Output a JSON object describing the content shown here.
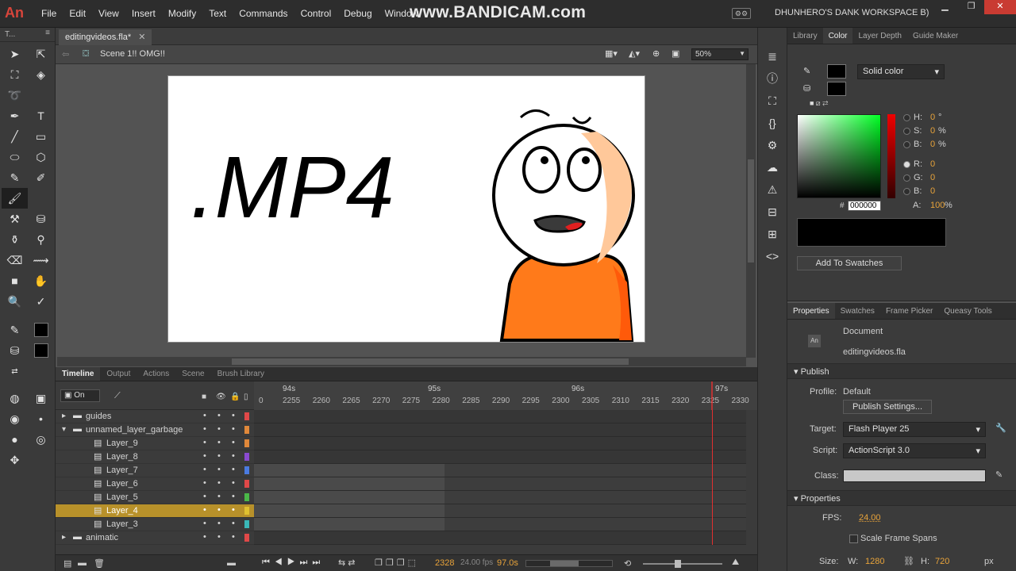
{
  "app": {
    "logo": "An",
    "watermark": "www.BANDICAM.com",
    "workspace": "DHUNHERO'S DANK WORKSPACE B)"
  },
  "menu": [
    "File",
    "Edit",
    "View",
    "Insert",
    "Modify",
    "Text",
    "Commands",
    "Control",
    "Debug",
    "Window"
  ],
  "tools_header": "T...",
  "document": {
    "tab_label": "editingvideos.fla*",
    "scene_label": "Scene 1!! OMG!!",
    "zoom": "50%"
  },
  "stage_text": ".MP4",
  "timeline": {
    "tabs": [
      "Timeline",
      "Output",
      "Actions",
      "Scene",
      "Brush Library"
    ],
    "onion_label": "On",
    "seconds": [
      "94s",
      "95s",
      "96s",
      "97s"
    ],
    "frame_ticks": [
      "0",
      "2255",
      "2260",
      "2265",
      "2270",
      "2275",
      "2280",
      "2285",
      "2290",
      "2295",
      "2300",
      "2305",
      "2310",
      "2315",
      "2320",
      "2325",
      "2330"
    ],
    "layers": [
      {
        "name": "guides",
        "kind": "folder",
        "color": "#e04848"
      },
      {
        "name": "unnamed_layer_garbage",
        "kind": "folder-open",
        "color": "#e0883a"
      },
      {
        "name": "Layer_9",
        "kind": "layer",
        "color": "#e0883a"
      },
      {
        "name": "Layer_8",
        "kind": "layer",
        "color": "#8a4ad0"
      },
      {
        "name": "Layer_7",
        "kind": "layer",
        "color": "#4a7ae0"
      },
      {
        "name": "Layer_6",
        "kind": "layer",
        "color": "#e04848"
      },
      {
        "name": "Layer_5",
        "kind": "layer",
        "color": "#4ab848"
      },
      {
        "name": "Layer_4",
        "kind": "layer",
        "color": "#e0c030",
        "selected": true
      },
      {
        "name": "Layer_3",
        "kind": "layer",
        "color": "#3ab8b8"
      },
      {
        "name": "animatic",
        "kind": "folder",
        "color": "#e04848"
      }
    ],
    "current_frame": "2328",
    "fps_display": "24.00 fps",
    "time_display": "97.0s"
  },
  "color_panel": {
    "tabs": [
      "Library",
      "Color",
      "Layer Depth",
      "Guide Maker"
    ],
    "fill_type": "Solid color",
    "hsb": [
      {
        "label": "H:",
        "value": "0",
        "unit": "°"
      },
      {
        "label": "S:",
        "value": "0",
        "unit": "%"
      },
      {
        "label": "B:",
        "value": "0",
        "unit": "%"
      }
    ],
    "rgb": [
      {
        "label": "R:",
        "value": "0"
      },
      {
        "label": "G:",
        "value": "0"
      },
      {
        "label": "B:",
        "value": "0"
      }
    ],
    "hex_label": "#",
    "hex": "000000",
    "alpha_label": "A:",
    "alpha": "100",
    "alpha_unit": "%",
    "add_swatches": "Add To Swatches",
    "accent": "#e8a33a"
  },
  "properties": {
    "tabs": [
      "Properties",
      "Swatches",
      "Frame Picker",
      "Queasy Tools"
    ],
    "doc_type": "Document",
    "doc_name": "editingvideos.fla",
    "doc_icon": "An",
    "publish_header": "Publish",
    "profile_label": "Profile:",
    "profile": "Default",
    "publish_settings": "Publish Settings...",
    "target_label": "Target:",
    "target": "Flash Player 25",
    "script_label": "Script:",
    "script": "ActionScript 3.0",
    "class_label": "Class:",
    "properties_header": "Properties",
    "fps_label": "FPS:",
    "fps": "24.00",
    "scale_spans": "Scale Frame Spans",
    "size_label": "Size:",
    "w_label": "W:",
    "w": "1280",
    "h_label": "H:",
    "h": "720",
    "unit": "px"
  }
}
